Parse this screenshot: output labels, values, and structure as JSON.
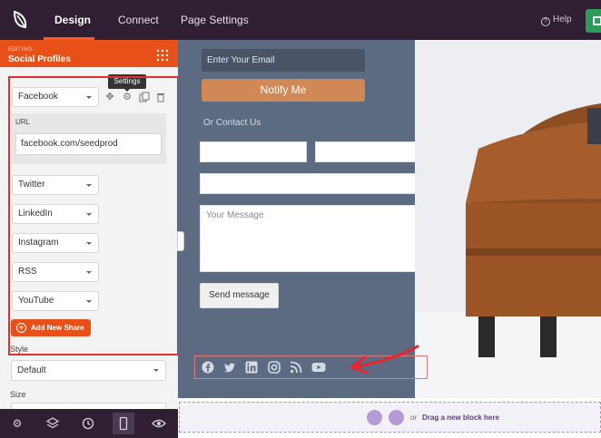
{
  "topbar": {
    "tabs": [
      "Design",
      "Connect",
      "Page Settings"
    ],
    "help_label": "Help"
  },
  "sidebar": {
    "editing_label": "EDITING:",
    "title": "Social Profiles",
    "tooltip": "Settings",
    "first_select": "Facebook",
    "url_label": "URL",
    "url_value": "facebook.com/seedprod",
    "networks": [
      "Twitter",
      "LinkedIn",
      "Instagram",
      "RSS",
      "YouTube"
    ],
    "add_button": "Add New Share",
    "style_label": "Style",
    "style_value": "Default",
    "size_label": "Size"
  },
  "preview": {
    "email_placeholder": "Enter Your Email",
    "notify_button": "Notify Me",
    "contact_label": "Or Contact Us",
    "message_placeholder": "Your Message",
    "send_button": "Send message",
    "social_icons": [
      "facebook-icon",
      "twitter-icon",
      "linkedin-icon",
      "instagram-icon",
      "rss-icon",
      "youtube-icon"
    ]
  },
  "dropzone": {
    "or": "or",
    "label": "Drag a new block here"
  },
  "colors": {
    "topbar": "#301f33",
    "accent": "#e8501a",
    "form_panel": "#5c6a82",
    "notify": "#d08857",
    "annotation": "#e03131"
  }
}
